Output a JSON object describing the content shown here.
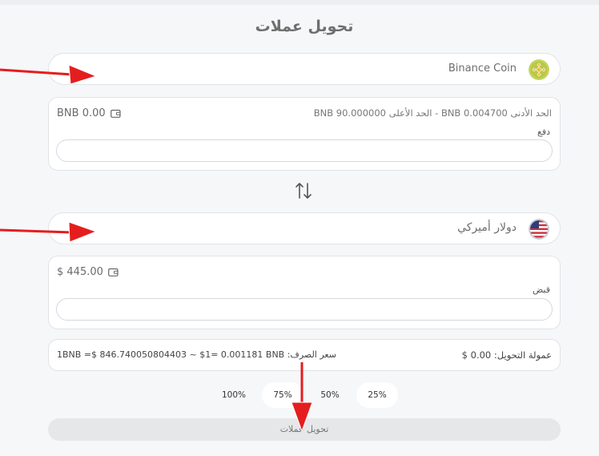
{
  "title": "تحويل عملات",
  "from": {
    "currency_name": "Binance Coin",
    "icon": "binance-coin-icon",
    "balance": "BNB 0.00",
    "limits_text": "الحد الأدنى  0.004700 BNB   -   الحد الأعلى  90.000000 BNB",
    "field_label": "دفع",
    "input_value": ""
  },
  "to": {
    "currency_name": "دولار أميركي",
    "icon": "us-flag-icon",
    "balance": "$ 445.00",
    "field_label": "قبض",
    "input_value": ""
  },
  "info": {
    "fee": "عمولة التحويل: 0.00 $",
    "rate": "سعر الصرف: 1BNB =$ 846.740050804403 ~ $1= 0.001181 BNB"
  },
  "percentages": [
    "25%",
    "50%",
    "75%",
    "100%"
  ],
  "submit_label": "تحويل عملات",
  "colors": {
    "annotation_arrow": "#e41e1e",
    "binance": "#f3ba2f",
    "background": "#f6f7f9"
  }
}
